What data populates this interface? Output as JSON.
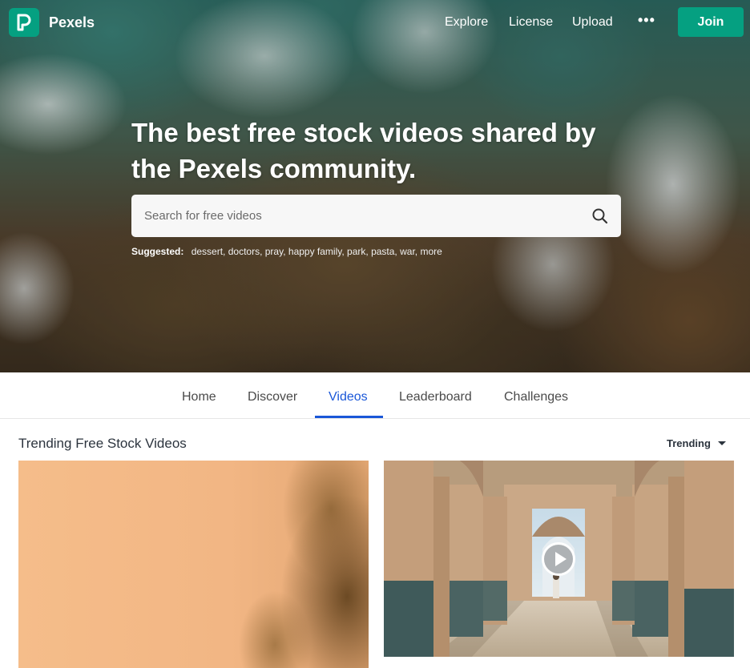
{
  "header": {
    "brand": "Pexels",
    "nav": [
      {
        "label": "Explore"
      },
      {
        "label": "License"
      },
      {
        "label": "Upload"
      }
    ],
    "more_label": "•••",
    "join_label": "Join"
  },
  "hero": {
    "title": "The best free stock videos shared by the Pexels community.",
    "search": {
      "placeholder": "Search for free videos",
      "value": ""
    },
    "suggested_label": "Suggested:",
    "suggested_tags": [
      "dessert,",
      "doctors,",
      "pray,",
      "happy family,",
      "park,",
      "pasta,",
      "war,",
      "more"
    ]
  },
  "tabs": [
    {
      "label": "Home",
      "active": false
    },
    {
      "label": "Discover",
      "active": false
    },
    {
      "label": "Videos",
      "active": true
    },
    {
      "label": "Leaderboard",
      "active": false
    },
    {
      "label": "Challenges",
      "active": false
    }
  ],
  "section": {
    "title": "Trending Free Stock Videos",
    "sort_label": "Trending"
  },
  "colors": {
    "brand": "#05a081",
    "active_tab": "#1a57d8",
    "text_dark": "#2c343e"
  },
  "icons": {
    "logo": "pexels-logo-icon",
    "search": "search-icon",
    "more": "more-dots-icon",
    "sort": "caret-down-icon",
    "play": "play-icon"
  }
}
